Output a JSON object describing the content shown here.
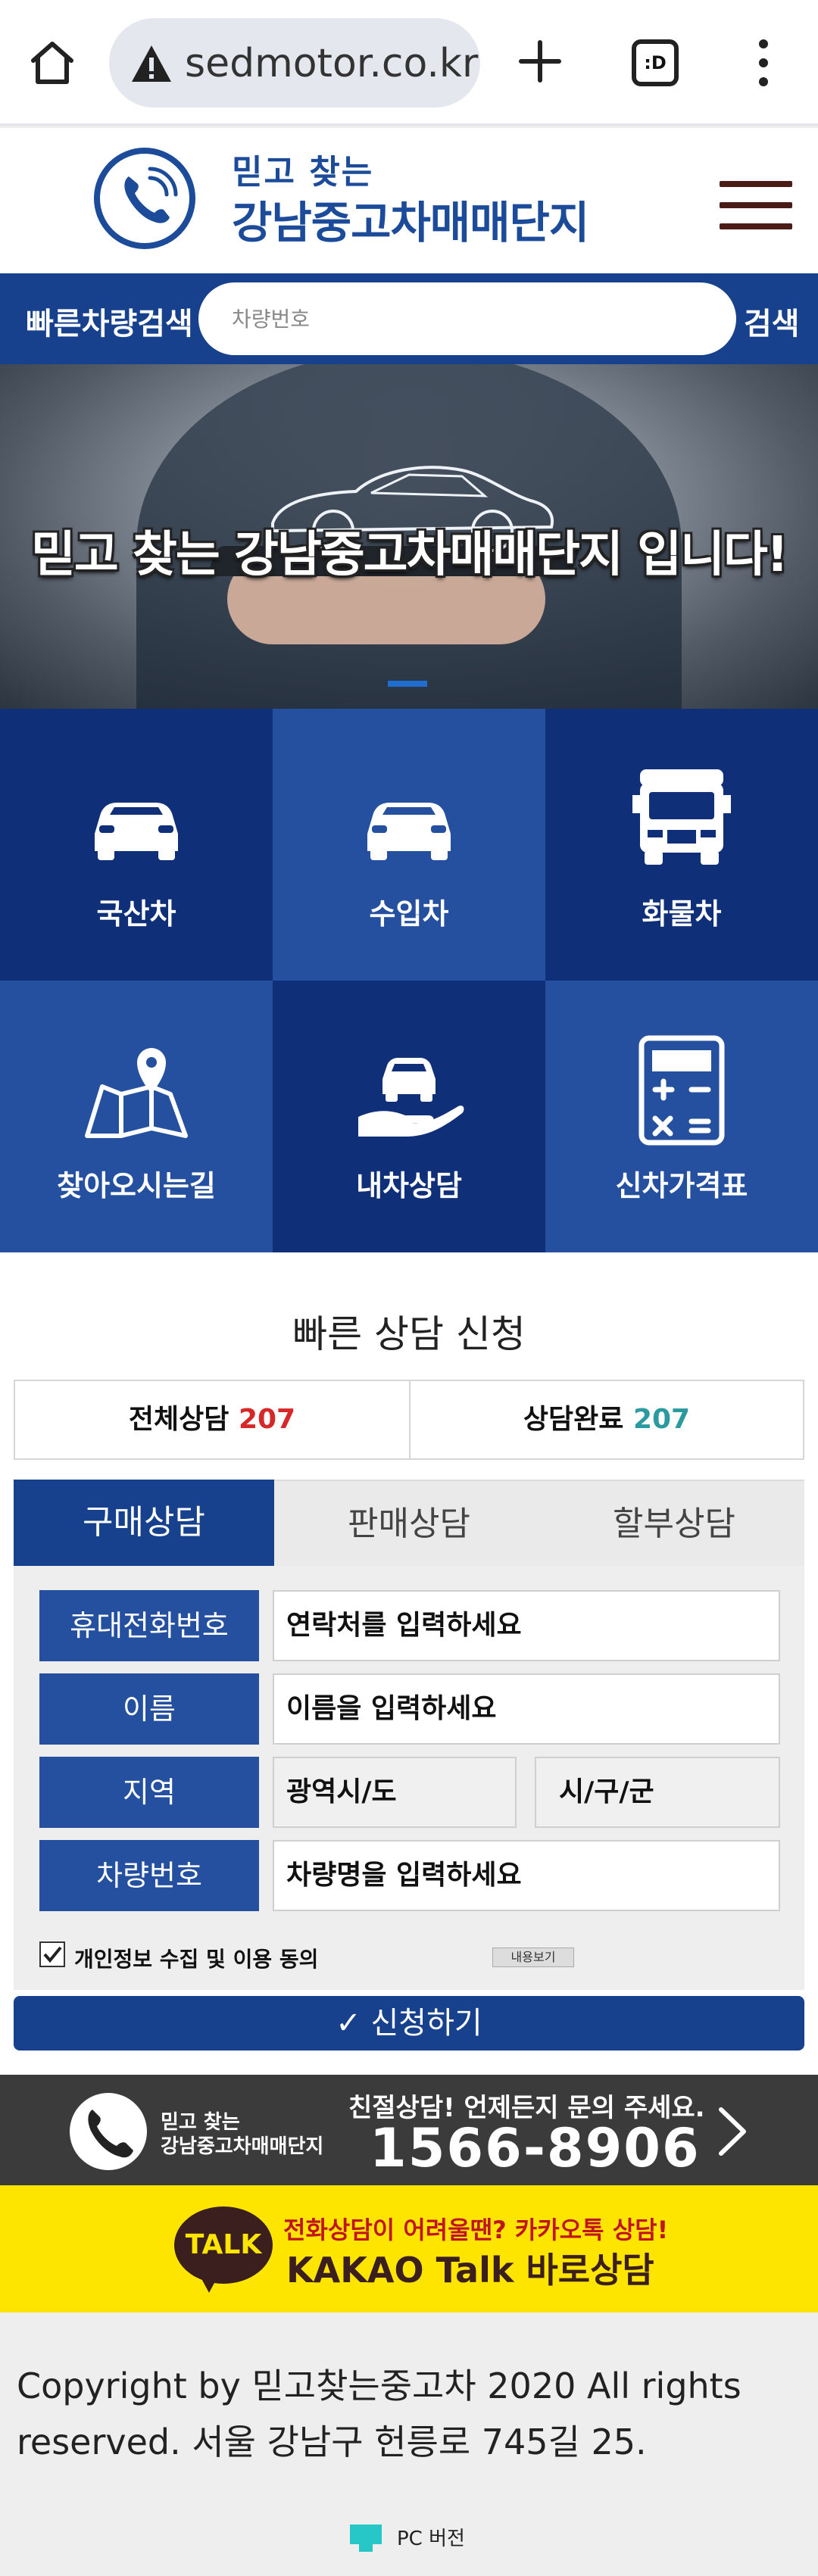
{
  "browser": {
    "url": "sedmotor.co.kr",
    "tabs_label": ":D"
  },
  "header": {
    "logo_line1": "믿고 찾는",
    "logo_line2": "강남중고차매매단지"
  },
  "quick_search": {
    "label": "빠른차량검색",
    "placeholder": "차량번호",
    "button": "검색"
  },
  "banner": {
    "headline": "믿고 찾는 강남중고차매매단지 입니다!"
  },
  "categories": [
    {
      "label": "국산차",
      "icon": "car-icon"
    },
    {
      "label": "수입차",
      "icon": "car-icon"
    },
    {
      "label": "화물차",
      "icon": "truck-icon"
    },
    {
      "label": "찾아오시는길",
      "icon": "map-icon"
    },
    {
      "label": "내차상담",
      "icon": "hand-car-icon"
    },
    {
      "label": "신차가격표",
      "icon": "calculator-icon"
    }
  ],
  "consult": {
    "title": "빠른 상담 신청",
    "stats": {
      "total_label": "전체상담",
      "total_value": "207",
      "done_label": "상담완료",
      "done_value": "207"
    },
    "tabs": [
      "구매상담",
      "판매상담",
      "할부상담"
    ],
    "form": {
      "phone_label": "휴대전화번호",
      "phone_placeholder": "연락처를 입력하세요",
      "name_label": "이름",
      "name_placeholder": "이름을 입력하세요",
      "region_label": "지역",
      "region_select1": "광역시/도",
      "region_select2": "시/구/군",
      "car_label": "차량번호",
      "car_placeholder": "차량명을 입력하세요",
      "agree_label": "개인정보 수집 및 이용 동의",
      "view_button": "내용보기",
      "submit": "✓ 신청하기"
    },
    "call": {
      "sub1": "믿고 찾는",
      "sub2": "강남중고차매매단지",
      "headline": "친절상담! 언제든지 문의 주세요.",
      "number": "1566-8906"
    },
    "kakao": {
      "badge": "TALK",
      "sub": "전화상담이 어려울땐? 카카오톡 상담!",
      "main": "KAKAO Talk 바로상담"
    }
  },
  "footer": {
    "copyright": "Copyright by  믿고찾는중고차 2020 All rights reserved. 서울 강남구 헌릉로 745길 25.",
    "pc_version": "PC 버전"
  },
  "colors": {
    "brand_blue": "#17408d",
    "grid_dark": "#102f79",
    "grid_light": "#24509f",
    "kakao_yellow": "#fde500"
  }
}
